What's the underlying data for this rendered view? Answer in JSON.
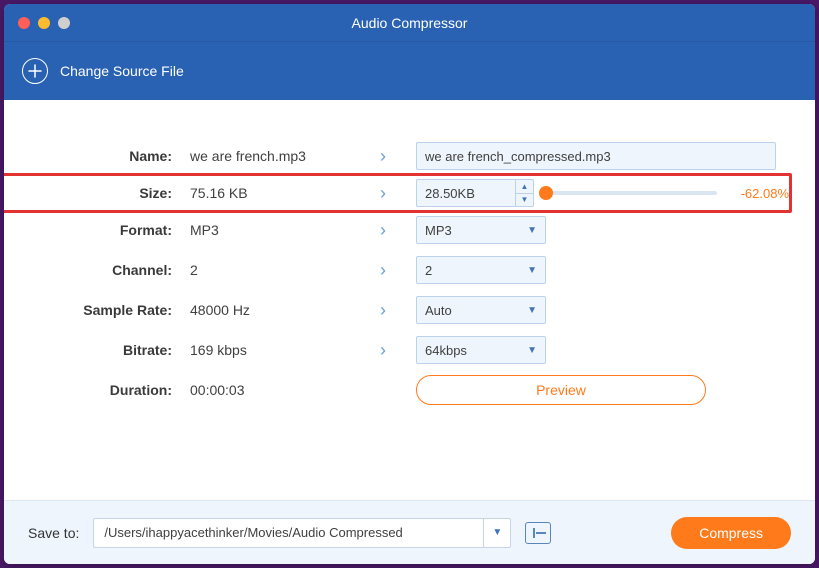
{
  "window": {
    "title": "Audio Compressor"
  },
  "toolbar": {
    "change_source": "Change Source File"
  },
  "rows": {
    "name": {
      "label": "Name:",
      "orig": "we are french.mp3",
      "dest": "we are french_compressed.mp3"
    },
    "size": {
      "label": "Size:",
      "orig": "75.16 KB",
      "dest": "28.50KB",
      "pct": "-62.08%"
    },
    "format": {
      "label": "Format:",
      "orig": "MP3",
      "dest": "MP3"
    },
    "channel": {
      "label": "Channel:",
      "orig": "2",
      "dest": "2"
    },
    "sample": {
      "label": "Sample Rate:",
      "orig": "48000 Hz",
      "dest": "Auto"
    },
    "bitrate": {
      "label": "Bitrate:",
      "orig": "169 kbps",
      "dest": "64kbps"
    },
    "duration": {
      "label": "Duration:",
      "orig": "00:00:03"
    }
  },
  "preview": "Preview",
  "footer": {
    "save_to": "Save to:",
    "path": "/Users/ihappyacethinker/Movies/Audio Compressed",
    "compress": "Compress"
  }
}
